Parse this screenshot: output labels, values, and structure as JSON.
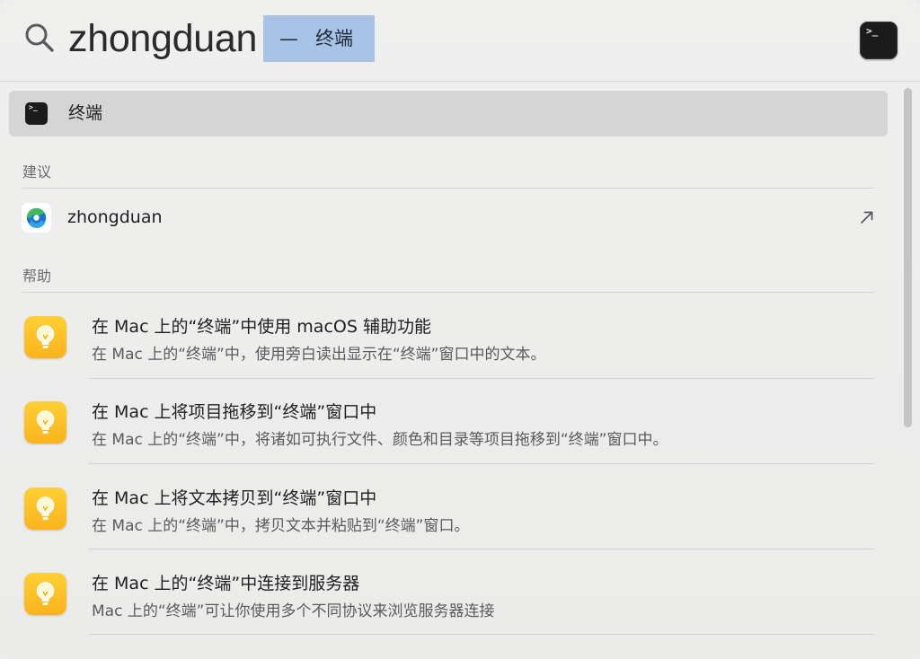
{
  "search": {
    "query": "zhongduan",
    "completion_dash": "—",
    "completion_text": "终端",
    "app_icon_glyph": ">_"
  },
  "top_hit": {
    "label": "终端",
    "icon_glyph": ">_"
  },
  "suggestions": {
    "header": "建议",
    "items": [
      {
        "label": "zhongduan",
        "icon": "edge-browser-icon"
      }
    ]
  },
  "help": {
    "header": "帮助",
    "items": [
      {
        "title": "在 Mac 上的“终端”中使用 macOS 辅助功能",
        "subtitle": "在 Mac 上的“终端”中，使用旁白读出显示在“终端”窗口中的文本。"
      },
      {
        "title": "在 Mac 上将项目拖移到“终端”窗口中",
        "subtitle": "在 Mac 上的“终端”中，将诸如可执行文件、颜色和目录等项目拖移到“终端”窗口中。"
      },
      {
        "title": "在 Mac 上将文本拷贝到“终端”窗口中",
        "subtitle": "在 Mac 上的“终端”中，拷贝文本并粘贴到“终端”窗口。"
      },
      {
        "title": "在 Mac 上的“终端”中连接到服务器",
        "subtitle": "Mac 上的“终端”可让你使用多个不同协议来浏览服务器连接"
      }
    ]
  },
  "colors": {
    "selection": "#d5d5d5",
    "completion_highlight": "#a8c3e6",
    "tip_icon": "#fbb31c",
    "edge_blue": "#1b74d4",
    "edge_green": "#3dbb5a"
  }
}
